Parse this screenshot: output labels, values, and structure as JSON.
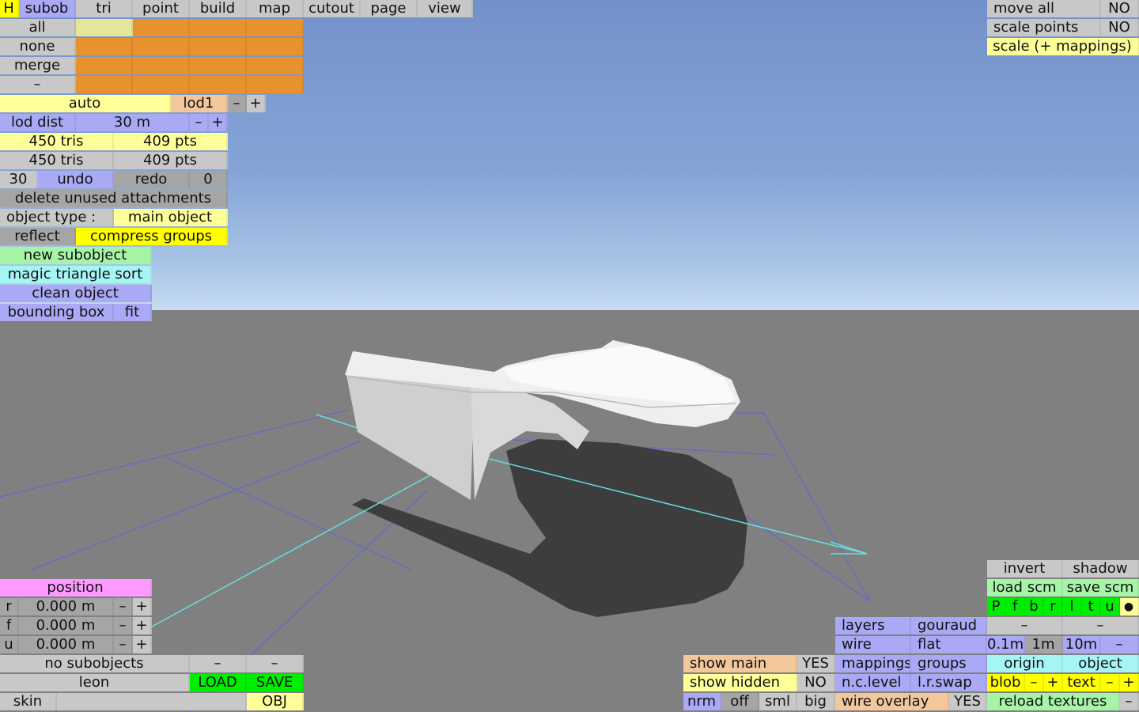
{
  "colors": {
    "sky": "#85a4d6",
    "ground": "#808080",
    "shadow": "#3d3d3d",
    "model": "#e8e8e8",
    "grid": "#6a6ac0",
    "axis": "#66e0e0"
  },
  "tabs": {
    "h": "H",
    "subob": "subob",
    "tri": "tri",
    "point": "point",
    "build": "build",
    "map": "map",
    "cutout": "cutout",
    "page": "page",
    "view": "view"
  },
  "selection": {
    "all": "all",
    "none": "none",
    "merge": "merge",
    "minus": "–"
  },
  "lod": {
    "auto": "auto",
    "name": "lod1",
    "minus": "–",
    "plus": "+",
    "dist_label": "lod dist",
    "dist_value": "30 m",
    "dist_minus": "–",
    "dist_plus": "+"
  },
  "stats": {
    "tris1": "450 tris",
    "pts1": "409 pts",
    "tris2": "450 tris",
    "pts2": "409 pts"
  },
  "history": {
    "count": "30",
    "undo": "undo",
    "redo": "redo",
    "redo_count": "0"
  },
  "actions": {
    "delete_unused": "delete unused attachments",
    "object_type_label": "object type :",
    "object_type_value": "main object",
    "reflect": "reflect",
    "compress_groups": "compress groups",
    "new_subobject": "new subobject",
    "magic_sort": "magic triangle sort",
    "clean_object": "clean object",
    "bounding_box": "bounding box",
    "fit": "fit"
  },
  "topright": {
    "move_all": "move all",
    "move_all_value": "NO",
    "scale_points": "scale points",
    "scale_points_value": "NO",
    "scale_mappings": "scale (+ mappings)"
  },
  "position": {
    "title": "position",
    "rows": [
      {
        "axis": "r",
        "value": "0.000 m",
        "minus": "–",
        "plus": "+"
      },
      {
        "axis": "f",
        "value": "0.000 m",
        "minus": "–",
        "plus": "+"
      },
      {
        "axis": "u",
        "value": "0.000 m",
        "minus": "–",
        "plus": "+"
      }
    ]
  },
  "bottomleft": {
    "no_subobjects": "no subobjects",
    "dash1": "–",
    "dash2": "–",
    "name": "leon",
    "load": "LOAD",
    "save": "SAVE",
    "skin": "skin",
    "skin_value": "",
    "obj": "OBJ"
  },
  "display": {
    "show_main": "show main",
    "show_main_value": "YES",
    "show_hidden": "show hidden",
    "show_hidden_value": "NO",
    "nrm": "nrm",
    "off": "off",
    "sml": "sml",
    "big": "big"
  },
  "render": {
    "layers": "layers",
    "gouraud": "gouraud",
    "wire": "wire",
    "flat": "flat",
    "mappings": "mappings",
    "groups": "groups",
    "nclevel": "n.c.level",
    "lrswap": "l.r.swap",
    "wire_overlay": "wire overlay",
    "wire_overlay_value": "YES"
  },
  "br": {
    "invert": "invert",
    "shadow": "shadow",
    "load_scm": "load scm",
    "save_scm": "save scm",
    "views": [
      "P",
      "f",
      "b",
      "r",
      "l",
      "t",
      "u",
      "●"
    ],
    "dash_a": "–",
    "dash_b": "–",
    "s01": "0.1m",
    "s1": "1m",
    "s10": "10m",
    "s_minus": "–",
    "origin": "origin",
    "object": "object",
    "blob": "blob",
    "blob_minus": "–",
    "blob_plus": "+",
    "text": "text",
    "text_minus": "–",
    "text_plus": "+",
    "reload": "reload textures",
    "reload_minus": "–"
  }
}
